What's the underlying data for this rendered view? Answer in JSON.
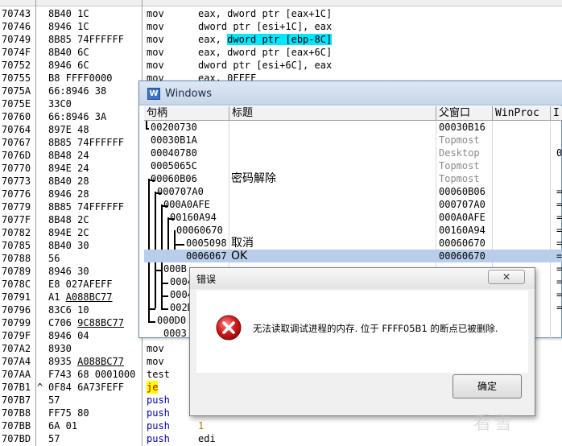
{
  "disasm": {
    "rows": [
      {
        "addr": "70743",
        "mark": "",
        "hex": "8B40 1C",
        "mnem": "mov",
        "ops": "eax, dword ptr [eax+1C]",
        "hl": ""
      },
      {
        "addr": "70746",
        "mark": "",
        "hex": "8946 1C",
        "mnem": "mov",
        "ops": "dword ptr [esi+1C], eax",
        "hl": ""
      },
      {
        "addr": "70749",
        "mark": "",
        "hex": "8B85 74FFFFFF",
        "mnem": "mov",
        "ops_pre": "eax, ",
        "ops_hl": "dword ptr [ebp-8C]",
        "hl": "cyan"
      },
      {
        "addr": "7074F",
        "mark": "",
        "hex": "8B40 6C",
        "mnem": "mov",
        "ops": "eax, dword ptr [eax+6C]",
        "hl": ""
      },
      {
        "addr": "70752",
        "mark": "",
        "hex": "8946 6C",
        "mnem": "mov",
        "ops": "dword ptr [esi+6C], eax",
        "hl": ""
      },
      {
        "addr": "70755",
        "mark": "",
        "hex": "B8 FFFF0000",
        "mnem": "mov",
        "ops": "eax, 0FFFF",
        "hl": ""
      },
      {
        "addr": "7075A",
        "mark": "",
        "hex": "66:8946 38",
        "mnem": "",
        "ops": "",
        "hl": ""
      },
      {
        "addr": "7075E",
        "mark": "",
        "hex": "33C0",
        "mnem": "",
        "ops": "",
        "hl": ""
      },
      {
        "addr": "70760",
        "mark": "",
        "hex": "66:8946 3A",
        "mnem": "",
        "ops": "",
        "hl": ""
      },
      {
        "addr": "70764",
        "mark": "",
        "hex": "897E 48",
        "mnem": "",
        "ops": "",
        "hl": ""
      },
      {
        "addr": "70767",
        "mark": "",
        "hex": "8B85 74FFFFFF",
        "mnem": "",
        "ops": "",
        "hl": ""
      },
      {
        "addr": "7076D",
        "mark": "",
        "hex": "8B48 24",
        "mnem": "",
        "ops": "",
        "hl": ""
      },
      {
        "addr": "70770",
        "mark": "",
        "hex": "894E 24",
        "mnem": "",
        "ops": "",
        "hl": ""
      },
      {
        "addr": "70773",
        "mark": "",
        "hex": "8B40 28",
        "mnem": "",
        "ops": "",
        "hl": ""
      },
      {
        "addr": "70776",
        "mark": "",
        "hex": "8946 28",
        "mnem": "",
        "ops": "",
        "hl": ""
      },
      {
        "addr": "70779",
        "mark": "",
        "hex": "8B85 74FFFFFF",
        "mnem": "",
        "ops": "",
        "hl": ""
      },
      {
        "addr": "7077F",
        "mark": "",
        "hex": "8B48 2C",
        "mnem": "",
        "ops": "",
        "hl": ""
      },
      {
        "addr": "70782",
        "mark": "",
        "hex": "894E 2C",
        "mnem": "",
        "ops": "",
        "hl": ""
      },
      {
        "addr": "70785",
        "mark": "",
        "hex": "8B40 30",
        "mnem": "",
        "ops": "",
        "hl": ""
      },
      {
        "addr": "70788",
        "mark": "",
        "hex": "56",
        "mnem": "",
        "ops": "",
        "hl": ""
      },
      {
        "addr": "70789",
        "mark": "",
        "hex": "8946 30",
        "mnem": "",
        "ops": "",
        "hl": ""
      },
      {
        "addr": "7078C",
        "mark": "",
        "hex": "E8 027AFEFF",
        "mnem": "",
        "ops": "",
        "hl": ""
      },
      {
        "addr": "70791",
        "mark": "",
        "hex_pre": "A1 ",
        "hex_ul": "A088BC77",
        "mnem": "",
        "ops": "",
        "hl": ""
      },
      {
        "addr": "70796",
        "mark": "",
        "hex": "83C6 10",
        "mnem": "",
        "ops": "",
        "hl": ""
      },
      {
        "addr": "70799",
        "mark": "",
        "hex_pre": "C706 ",
        "hex_ul": "9C88BC77",
        "mnem": "",
        "ops": "",
        "hl": ""
      },
      {
        "addr": "7079F",
        "mark": "",
        "hex": "8946 04",
        "mnem": "",
        "ops": "",
        "hl": ""
      },
      {
        "addr": "707A2",
        "mark": "",
        "hex": "8930",
        "mnem": "mov",
        "ops": "",
        "hl": ""
      },
      {
        "addr": "707A4",
        "mark": "",
        "hex_pre": "8935 ",
        "hex_ul": "A088BC77",
        "mnem": "mov",
        "ops": "",
        "hl": ""
      },
      {
        "addr": "707AA",
        "mark": "",
        "hex": "F743 68 0001000",
        "mnem": "test",
        "ops": "",
        "hl": ""
      },
      {
        "addr": "707B1",
        "mark": "^",
        "hex": "0F84 6A73FEFF",
        "mnem": "je",
        "ops": "",
        "hl": "je"
      },
      {
        "addr": "707B7",
        "mark": "",
        "hex": "57",
        "mnem": "push",
        "ops": "",
        "hl": "push"
      },
      {
        "addr": "707B8",
        "mark": "",
        "hex": "FF75 80",
        "mnem": "push",
        "ops": "",
        "hl": "push"
      },
      {
        "addr": "707BB",
        "mark": "",
        "hex": "6A 01",
        "mnem": "push",
        "ops": "1",
        "hl": "push-lit"
      },
      {
        "addr": "707BD",
        "mark": "",
        "hex": "57",
        "mnem": "push",
        "ops": "edi",
        "hl": "push"
      }
    ]
  },
  "windows_dialog": {
    "title": "Windows",
    "icon": "windows-app-icon",
    "columns": [
      "句柄",
      "标题",
      "父窗口",
      "WinProc",
      "I"
    ],
    "rows": [
      {
        "handle": "00200730",
        "title": "",
        "parent": "00030B16",
        "extra": "",
        "gray": false,
        "selected": false
      },
      {
        "handle": "00030B1A",
        "title": "",
        "parent": "Topmost",
        "extra": "",
        "gray": true,
        "selected": false
      },
      {
        "handle": "00040780",
        "title": "",
        "parent": "Desktop",
        "extra": "0",
        "gray": true,
        "selected": false
      },
      {
        "handle": "0005065C",
        "title": "",
        "parent": "Topmost",
        "extra": "",
        "gray": true,
        "selected": false
      },
      {
        "handle": "00060B06",
        "title": "密码解除",
        "parent": "Topmost",
        "extra": "",
        "gray": true,
        "selected": false
      },
      {
        "handle": "000707A0",
        "title": "",
        "parent": "00060B06",
        "extra": "=",
        "gray": false,
        "selected": false
      },
      {
        "handle": "000A0AFE",
        "title": "",
        "parent": "000707A0",
        "extra": "=",
        "gray": false,
        "selected": false
      },
      {
        "handle": "00160A94",
        "title": "",
        "parent": "000A0AFE",
        "extra": "=",
        "gray": false,
        "selected": false
      },
      {
        "handle": "00060670",
        "title": "",
        "parent": "00160A94",
        "extra": "=",
        "gray": false,
        "selected": false
      },
      {
        "handle": "0005098",
        "title": "取消",
        "parent": "00060670",
        "extra": "=",
        "gray": false,
        "selected": false
      },
      {
        "handle": "0006067",
        "title": "OK",
        "parent": "00060670",
        "extra": "=",
        "gray": false,
        "selected": true
      },
      {
        "handle": "000B",
        "title": "",
        "parent": "",
        "extra": "=",
        "gray": false,
        "selected": false
      },
      {
        "handle": "0004",
        "title": "",
        "parent": "",
        "extra": "=",
        "gray": false,
        "selected": false
      },
      {
        "handle": "0004",
        "title": "",
        "parent": "",
        "extra": "=",
        "gray": false,
        "selected": false
      },
      {
        "handle": "002D",
        "title": "",
        "parent": "",
        "extra": "=",
        "gray": false,
        "selected": false
      },
      {
        "handle": "000D0",
        "title": "",
        "parent": "",
        "extra": "",
        "gray": false,
        "selected": false
      },
      {
        "handle": "0003",
        "title": "",
        "parent": "",
        "extra": "",
        "gray": false,
        "selected": false
      }
    ]
  },
  "error_dialog": {
    "title": "错误",
    "close_label": "✕",
    "icon": "error-icon",
    "message": "无法读取调试进程的内存. 位于 FFFF05B1 的断点已被删除.",
    "ok_label": "确定"
  },
  "watermark": "看雪",
  "colors": {
    "highlight_cyan": "#00e6ff",
    "highlight_yellow": "#ffff00",
    "selection": "#b8cdea",
    "error_red": "#d21b1b"
  }
}
